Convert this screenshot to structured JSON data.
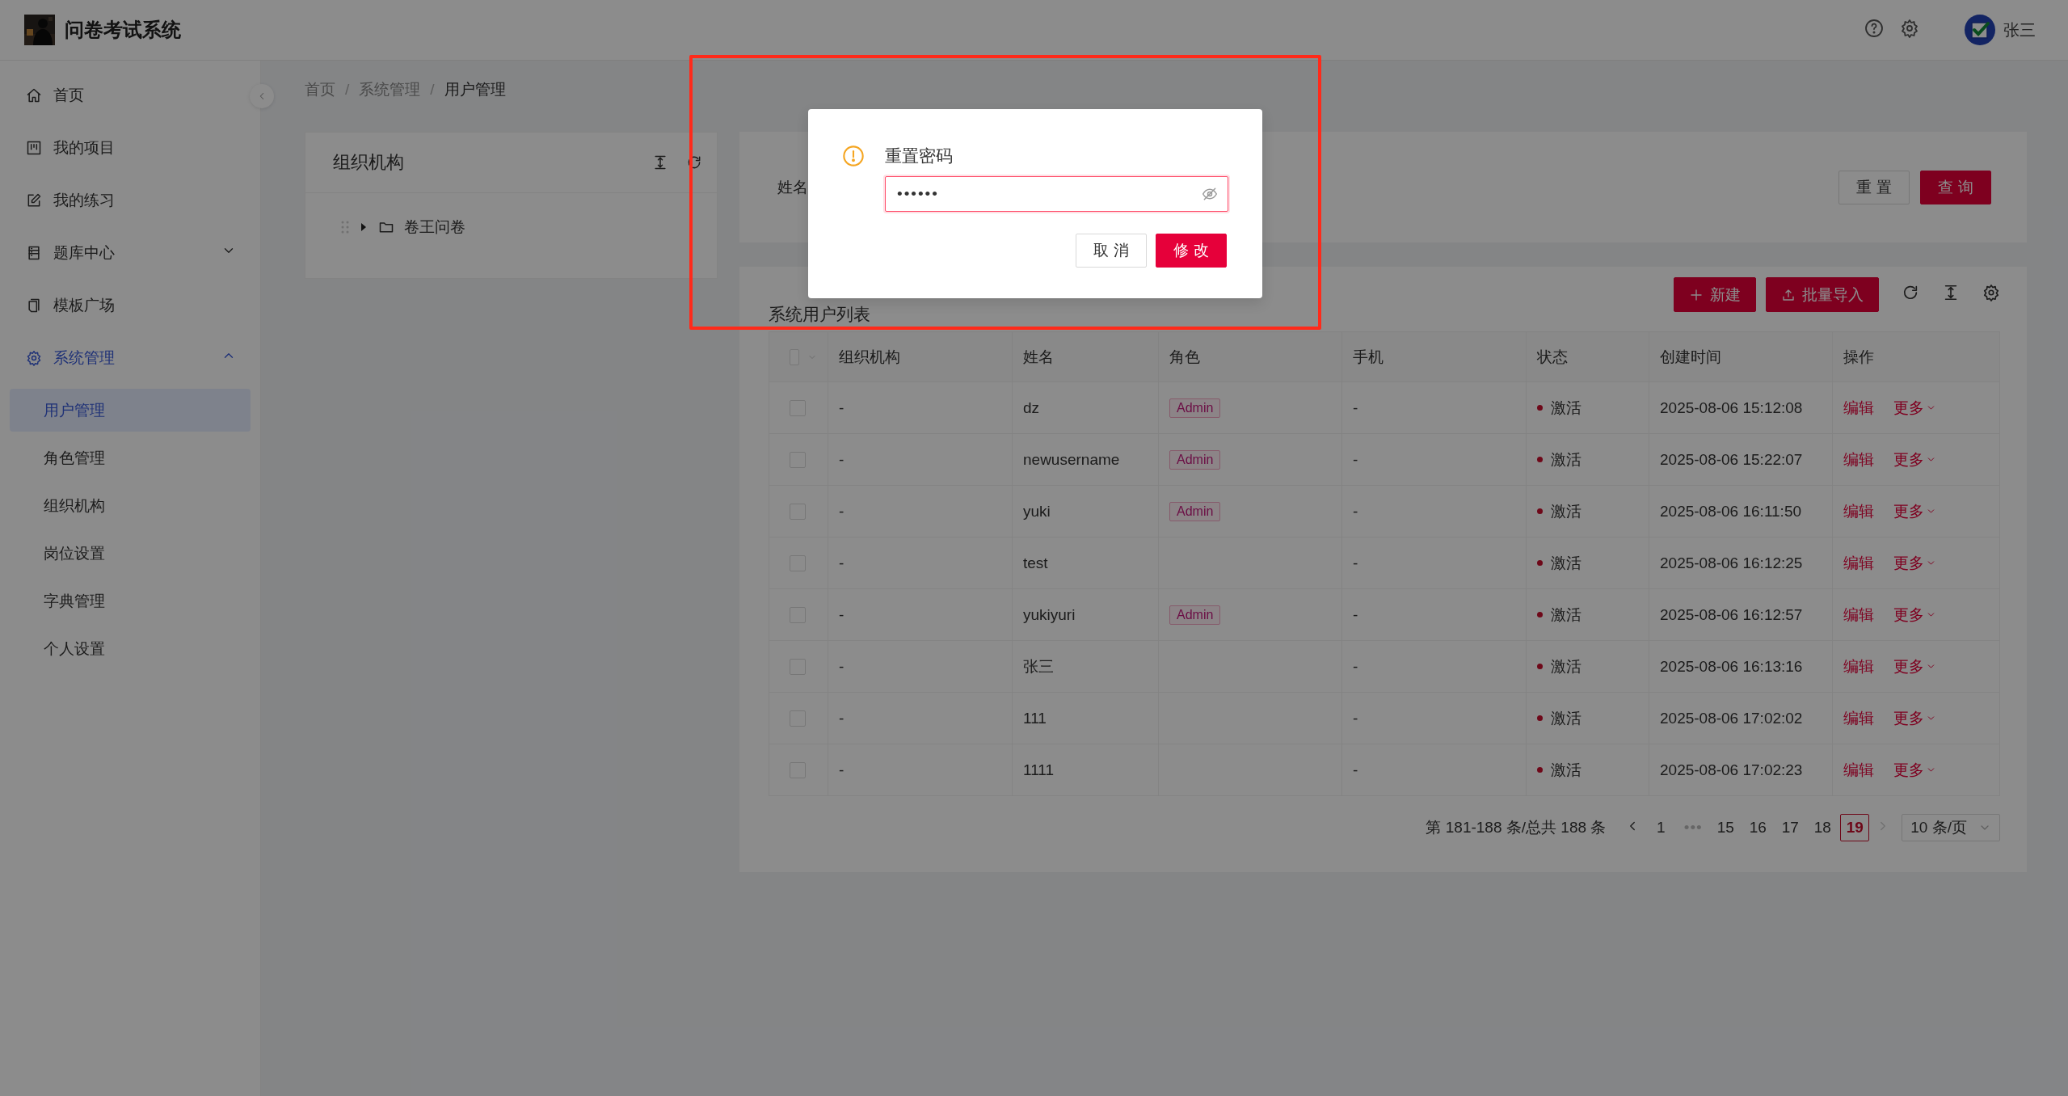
{
  "header": {
    "title": "问卷考试系统",
    "user": "张三"
  },
  "sidebar": {
    "items": [
      {
        "label": "首页",
        "selected": false
      },
      {
        "label": "我的项目",
        "selected": false
      },
      {
        "label": "我的练习",
        "selected": false
      },
      {
        "label": "题库中心",
        "selected": false,
        "expanded": false
      },
      {
        "label": "模板广场",
        "selected": false
      },
      {
        "label": "系统管理",
        "selected": true,
        "expanded": true,
        "children": [
          {
            "label": "用户管理",
            "selected": true
          },
          {
            "label": "角色管理",
            "selected": false
          },
          {
            "label": "组织机构",
            "selected": false
          },
          {
            "label": "岗位设置",
            "selected": false
          },
          {
            "label": "字典管理",
            "selected": false
          },
          {
            "label": "个人设置",
            "selected": false
          }
        ]
      }
    ]
  },
  "breadcrumb": {
    "items": [
      "首页",
      "系统管理",
      "用户管理"
    ],
    "separator": "/"
  },
  "org_panel": {
    "title": "组织机构",
    "tree": [
      {
        "label": "卷王问卷",
        "expanded": false
      }
    ]
  },
  "search": {
    "label": "姓名",
    "buttons": [
      {
        "label": "重置",
        "kind": "default"
      },
      {
        "label": "查询",
        "kind": "primary"
      }
    ]
  },
  "table": {
    "title": "系统用户列表",
    "actions": [
      {
        "label": "新建",
        "kind": "add"
      },
      {
        "label": "批量导入",
        "kind": "import"
      }
    ],
    "select_all": {
      "checked": false
    },
    "columns": [
      "组织机构",
      "姓名",
      "角色",
      "手机",
      "状态",
      "创建时间",
      "操作"
    ],
    "rows": [
      {
        "checked": false,
        "org": "-",
        "name": "dz",
        "role": "Admin",
        "phone": "-",
        "status": "激活",
        "created": "2025-08-06 15:12:08",
        "actions": [
          "编辑",
          "更多"
        ]
      },
      {
        "checked": false,
        "org": "-",
        "name": "newusername",
        "role": "Admin",
        "phone": "-",
        "status": "激活",
        "created": "2025-08-06 15:22:07",
        "actions": [
          "编辑",
          "更多"
        ]
      },
      {
        "checked": false,
        "org": "-",
        "name": "yuki",
        "role": "Admin",
        "phone": "-",
        "status": "激活",
        "created": "2025-08-06 16:11:50",
        "actions": [
          "编辑",
          "更多"
        ]
      },
      {
        "checked": false,
        "org": "-",
        "name": "test",
        "phone": "-",
        "status": "激活",
        "created": "2025-08-06 16:12:25",
        "actions": [
          "编辑",
          "更多"
        ]
      },
      {
        "checked": false,
        "org": "-",
        "name": "yukiyuri",
        "role": "Admin",
        "phone": "-",
        "status": "激活",
        "created": "2025-08-06 16:12:57",
        "actions": [
          "编辑",
          "更多"
        ]
      },
      {
        "checked": false,
        "org": "-",
        "name": "张三",
        "phone": "-",
        "status": "激活",
        "created": "2025-08-06 16:13:16",
        "actions": [
          "编辑",
          "更多"
        ]
      },
      {
        "checked": false,
        "org": "-",
        "name": "111",
        "phone": "-",
        "status": "激活",
        "created": "2025-08-06 17:02:02",
        "actions": [
          "编辑",
          "更多"
        ]
      },
      {
        "checked": false,
        "org": "-",
        "name": "1111",
        "phone": "-",
        "status": "激活",
        "created": "2025-08-06 17:02:23",
        "actions": [
          "编辑",
          "更多"
        ]
      }
    ]
  },
  "pagination": {
    "summary": "第 181-188 条/总共 188 条",
    "prev": {
      "disabled": false
    },
    "next": {
      "disabled": true
    },
    "pages": [
      {
        "label": "1",
        "kind": "page",
        "selected": false
      },
      {
        "label": "•••",
        "kind": "ellipsis",
        "selected": false
      },
      {
        "label": "15",
        "kind": "page",
        "selected": false
      },
      {
        "label": "16",
        "kind": "page",
        "selected": false
      },
      {
        "label": "17",
        "kind": "page",
        "selected": false
      },
      {
        "label": "18",
        "kind": "page",
        "selected": false
      },
      {
        "label": "19",
        "kind": "page",
        "selected": true
      }
    ],
    "page_size": "10 条/页"
  },
  "dialog": {
    "title": "重置密码",
    "password": "••••••",
    "buttons": [
      {
        "label": "取消",
        "kind": "default"
      },
      {
        "label": "修改",
        "kind": "primary"
      }
    ]
  }
}
